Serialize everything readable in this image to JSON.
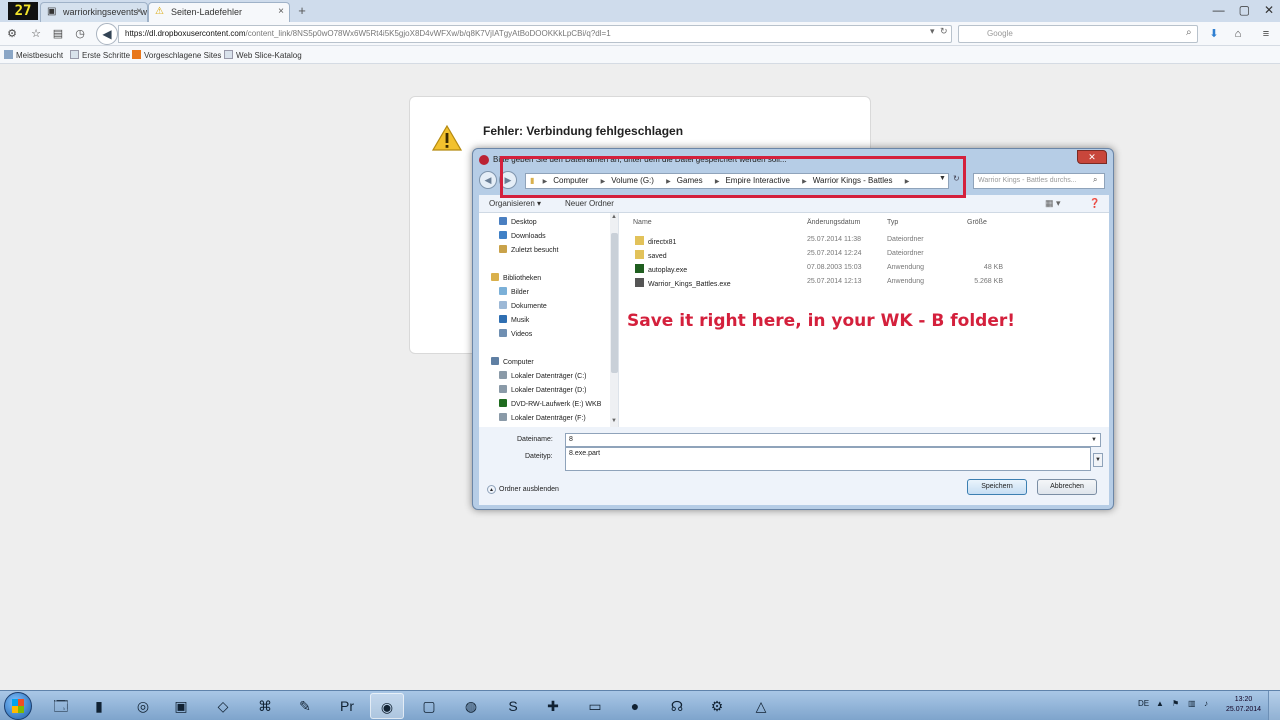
{
  "browser": {
    "app_logo": "27",
    "tabs": [
      {
        "label": "warriorkingsevents w...",
        "active": false
      },
      {
        "label": "Seiten-Ladefehler",
        "active": true
      }
    ],
    "new_tab_label": "+",
    "url_host": "https://dl.dropboxusercontent.com",
    "url_path": "/content_link/8NS5p0wO78Wx6W5Rt4i5K5gjoX8D4vWFXw/b/q8K7VjIATgyAtBoDOOKKkLpCBi/q?dl=1",
    "search_engine_badge": "8",
    "search_placeholder": "Google",
    "bookmarks": [
      {
        "label": "Meistbesucht"
      },
      {
        "label": "Erste Schritte"
      },
      {
        "label": "Vorgeschlagene Sites"
      },
      {
        "label": "Web Slice-Katalog"
      }
    ]
  },
  "error_page": {
    "title": "Fehler: Verbindung fehlgeschlagen"
  },
  "dialog": {
    "title": "Bitte geben Sie den Dateinamen an, unter dem die Datei gespeichert werden soll...",
    "path": [
      "Computer",
      "Volume (G:)",
      "Games",
      "Empire Interactive",
      "Warrior Kings - Battles"
    ],
    "search_placeholder": "Warrior Kings - Battles durchs...",
    "toolbar": {
      "organize": "Organisieren ▾",
      "new_folder": "Neuer Ordner"
    },
    "nav_items": [
      {
        "label": "Desktop",
        "icon": "desktop-icon",
        "color": "#4a7fc1",
        "indent": 1
      },
      {
        "label": "Downloads",
        "icon": "downloads-icon",
        "color": "#3f80c6",
        "indent": 1
      },
      {
        "label": "Zuletzt besucht",
        "icon": "recent-icon",
        "color": "#c9a24a",
        "indent": 1
      },
      {
        "label": "Bibliotheken",
        "icon": "libraries-icon",
        "color": "#d9b04c",
        "indent": 0
      },
      {
        "label": "Bilder",
        "icon": "pictures-icon",
        "color": "#7bb0d8",
        "indent": 1
      },
      {
        "label": "Dokumente",
        "icon": "documents-icon",
        "color": "#9cb8d6",
        "indent": 1
      },
      {
        "label": "Musik",
        "icon": "music-icon",
        "color": "#2f6fb2",
        "indent": 1
      },
      {
        "label": "Videos",
        "icon": "videos-icon",
        "color": "#6f8fb2",
        "indent": 1
      },
      {
        "label": "Computer",
        "icon": "computer-icon",
        "color": "#5f7fa3",
        "indent": 0
      },
      {
        "label": "Lokaler Datenträger (C:)",
        "icon": "drive-icon",
        "color": "#8a9aa8",
        "indent": 1
      },
      {
        "label": "Lokaler Datenträger (D:)",
        "icon": "drive-icon",
        "color": "#8a9aa8",
        "indent": 1
      },
      {
        "label": "DVD-RW-Laufwerk (E:) WKB",
        "icon": "dvd-icon",
        "color": "#1f6b1f",
        "indent": 1
      },
      {
        "label": "Lokaler Datenträger (F:)",
        "icon": "drive-icon",
        "color": "#8a9aa8",
        "indent": 1
      }
    ],
    "columns": {
      "name": "Name",
      "date": "Änderungsdatum",
      "type": "Typ",
      "size": "Größe"
    },
    "files": [
      {
        "name": "directx81",
        "date": "25.07.2014 11:38",
        "type": "Dateiordner",
        "size": "",
        "icon": "folder-icon",
        "color": "#e2c25a"
      },
      {
        "name": "saved",
        "date": "25.07.2014 12:24",
        "type": "Dateiordner",
        "size": "",
        "icon": "folder-icon",
        "color": "#e2c25a"
      },
      {
        "name": "autoplay.exe",
        "date": "07.08.2003 15:03",
        "type": "Anwendung",
        "size": "48 KB",
        "icon": "exe-icon",
        "color": "#1f5e1f"
      },
      {
        "name": "Warrior_Kings_Battles.exe",
        "date": "25.07.2014 12:13",
        "type": "Anwendung",
        "size": "5.268 KB",
        "icon": "exe-icon",
        "color": "#555555"
      }
    ],
    "filename_label": "Dateiname:",
    "filename_value": "8",
    "filetype_label": "Dateityp:",
    "filetype_value": "8.exe.part",
    "hide_folders": "Ordner ausblenden",
    "save_button": "Speichern",
    "cancel_button": "Abbrechen"
  },
  "annotation": {
    "text": "Save it right here, in your WK - B folder!",
    "color": "#d4203c"
  },
  "taskbar": {
    "language": "DE",
    "time": "13:20",
    "date": "25.07.2014"
  }
}
